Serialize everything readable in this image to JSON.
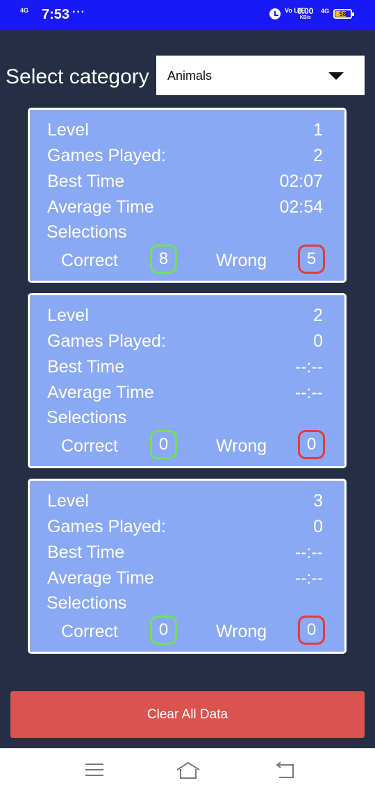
{
  "status_bar": {
    "network": "4G",
    "time": "7:53",
    "dots": "···",
    "volte": "Vo LTE",
    "speed_value": "0.00",
    "speed_unit": "KB/s",
    "network2": "4G",
    "battery": "58"
  },
  "category": {
    "label": "Select category",
    "selected": "Animals"
  },
  "labels": {
    "level": "Level",
    "games_played": "Games Played:",
    "best_time": "Best Time",
    "average_time": "Average Time",
    "selections": "Selections",
    "correct": "Correct",
    "wrong": "Wrong"
  },
  "levels": [
    {
      "level": "1",
      "games_played": "2",
      "best_time": "02:07",
      "average_time": "02:54",
      "correct": "8",
      "wrong": "5"
    },
    {
      "level": "2",
      "games_played": "0",
      "best_time": "--:--",
      "average_time": "--:--",
      "correct": "0",
      "wrong": "0"
    },
    {
      "level": "3",
      "games_played": "0",
      "best_time": "--:--",
      "average_time": "--:--",
      "correct": "0",
      "wrong": "0"
    }
  ],
  "clear_button": "Clear All Data",
  "icons": {
    "alarm": "alarm-icon",
    "battery": "battery-icon",
    "menu": "menu-icon",
    "home": "home-icon",
    "back": "back-icon",
    "dropdown": "caret-down-icon"
  },
  "colors": {
    "background": "#262e45",
    "status_bar": "#1919f5",
    "card": "#8aa9f4",
    "correct_border": "#6ee25c",
    "wrong_border": "#e33b3b",
    "clear_button": "#d9534f"
  }
}
